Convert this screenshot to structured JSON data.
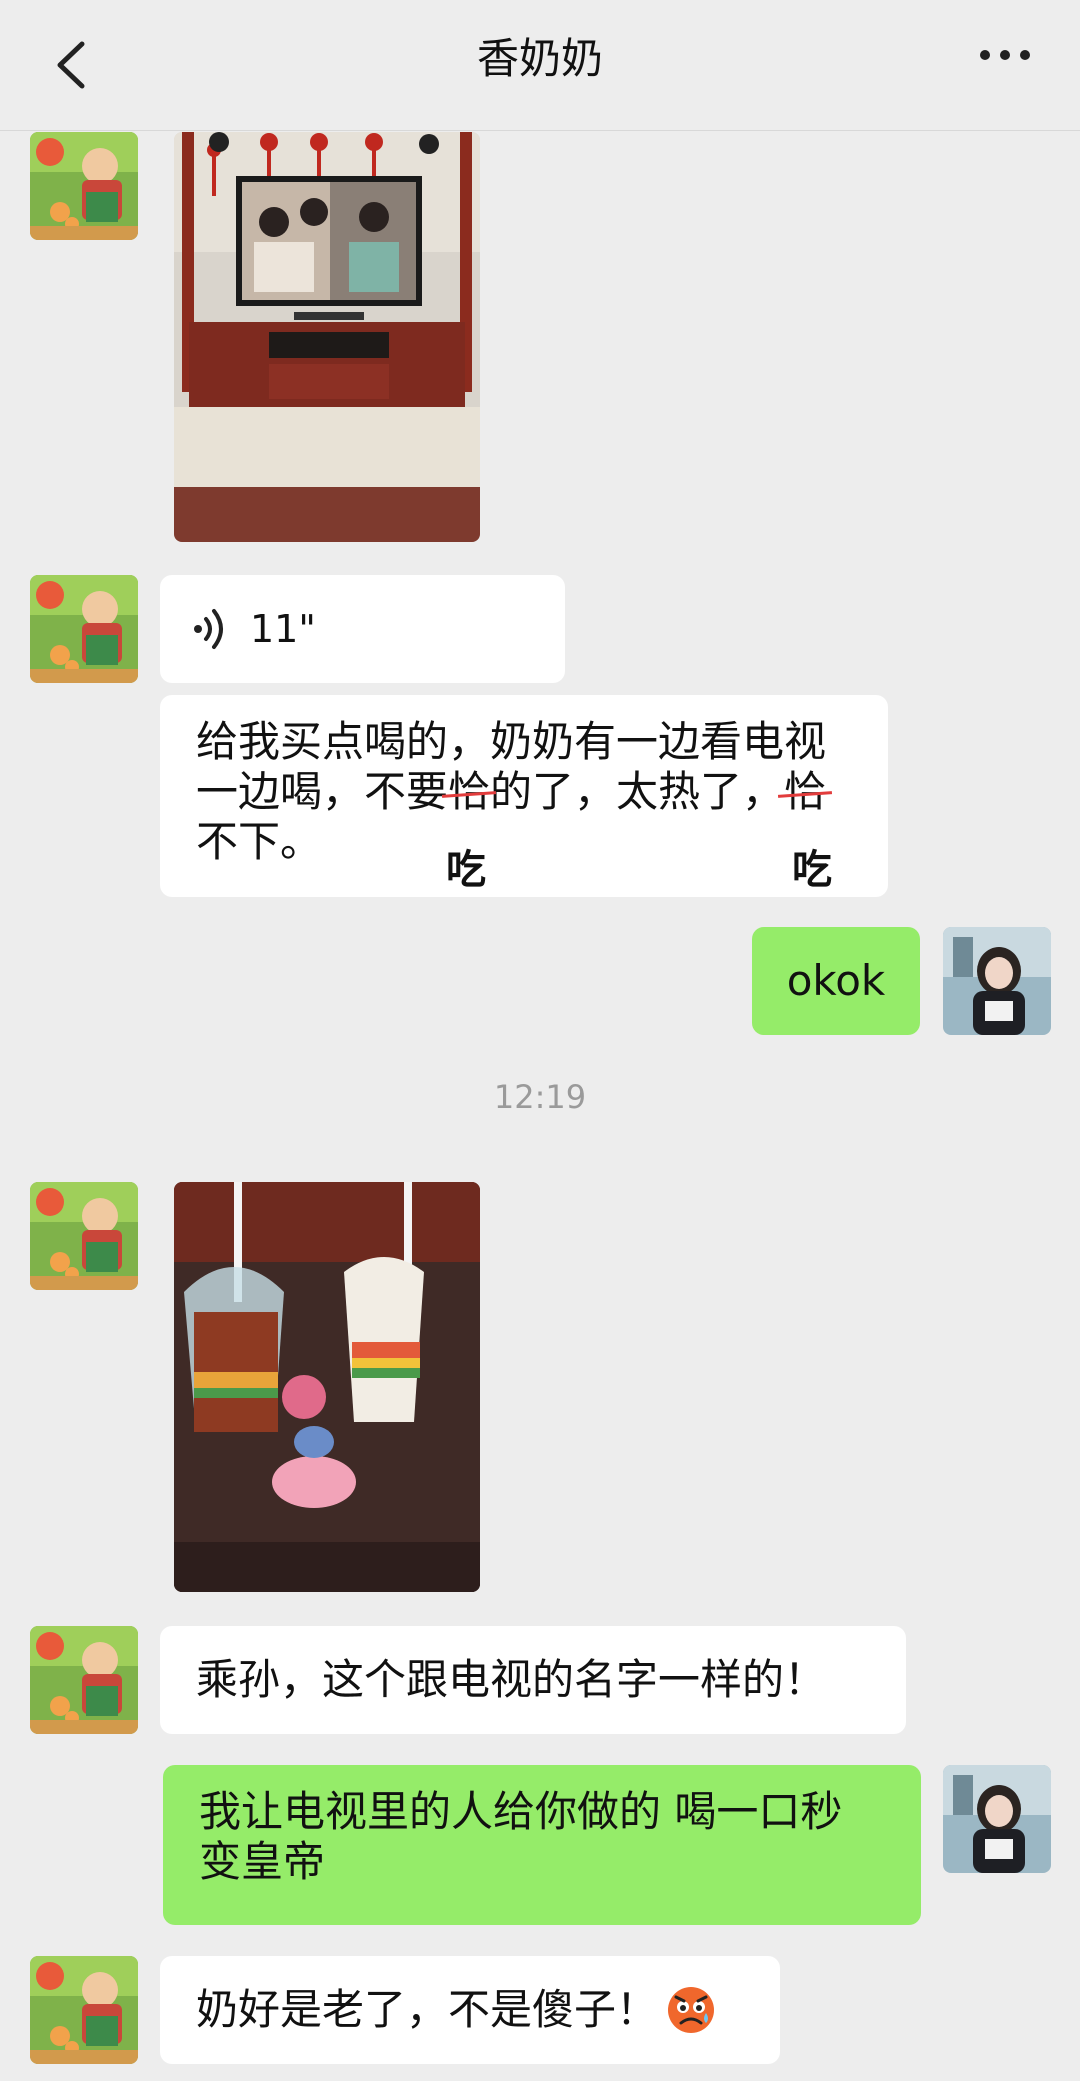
{
  "header": {
    "title": "香奶奶"
  },
  "messages": {
    "voice_duration": "11\"",
    "text1_lines": [
      "给我买点喝的，奶奶有一边看电视",
      "一边喝，不要",
      "的了，太热了，",
      "不下。"
    ],
    "text1_struck_1": "恰",
    "text1_struck_2": "恰",
    "text1_correction_1": "吃",
    "text1_correction_2": "吃",
    "reply1": "okok",
    "time": "12:19",
    "text2": "乘孙，这个跟电视的名字一样的！",
    "reply2_lines": [
      "我让电视里的人给你做的 喝一口秒",
      "变皇帝"
    ],
    "text3": "奶好是老了，不是傻子！"
  },
  "colors": {
    "background": "#ededed",
    "bubble_self": "#95ec69",
    "bubble_other": "#ffffff"
  },
  "icons": [
    "back-arrow-icon",
    "more-dots-icon",
    "voice-wave-icon",
    "sweat-emoji-icon"
  ]
}
